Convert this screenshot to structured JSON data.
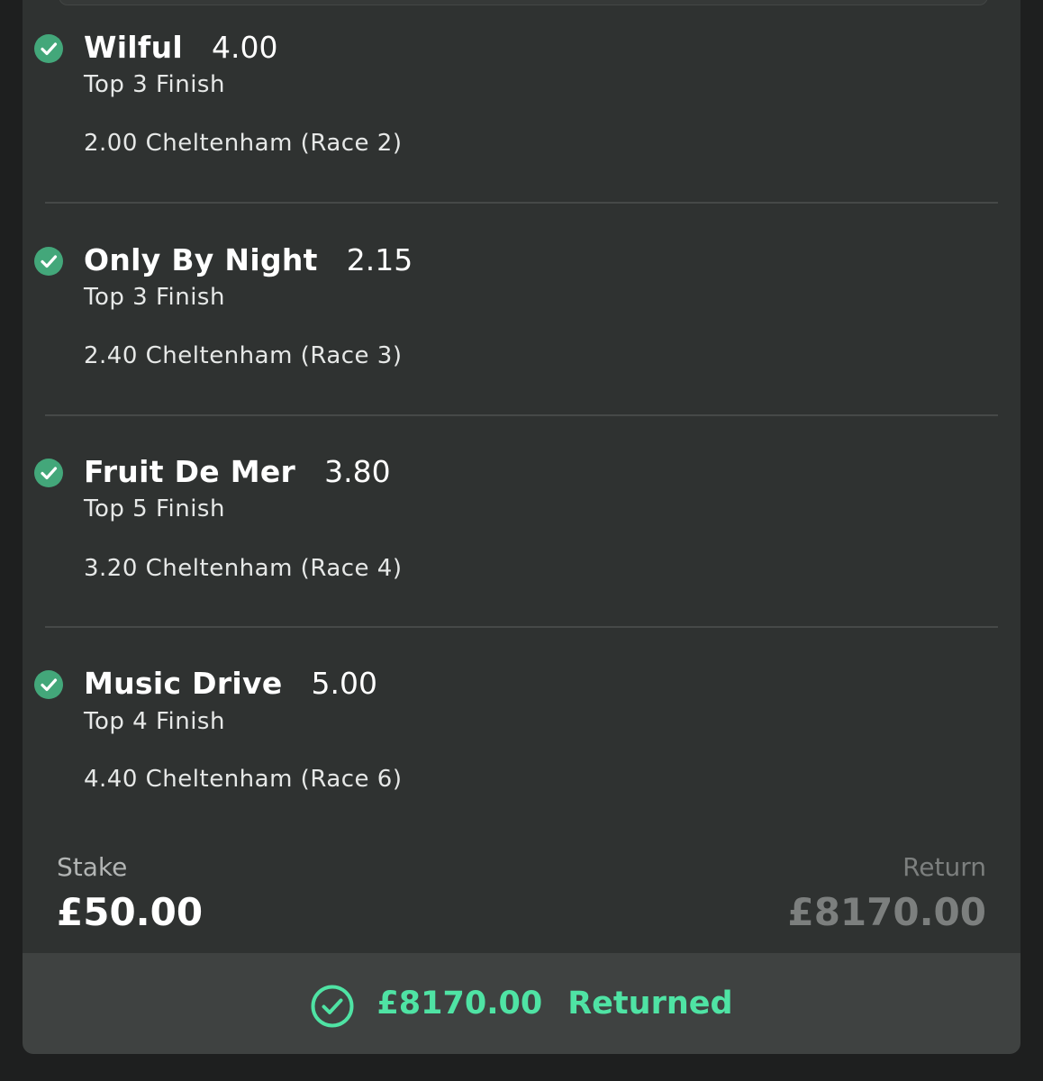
{
  "selections": [
    {
      "name": "Wilful",
      "odds": "4.00",
      "market": "Top 3 Finish",
      "event": "2.00 Cheltenham (Race 2)",
      "status_icon": "check-circle-icon"
    },
    {
      "name": "Only By Night",
      "odds": "2.15",
      "market": "Top 3 Finish",
      "event": "2.40 Cheltenham (Race 3)",
      "status_icon": "check-circle-icon"
    },
    {
      "name": "Fruit De Mer",
      "odds": "3.80",
      "market": "Top 5 Finish",
      "event": "3.20 Cheltenham (Race 4)",
      "status_icon": "check-circle-icon"
    },
    {
      "name": "Music Drive",
      "odds": "5.00",
      "market": "Top 4 Finish",
      "event": "4.40 Cheltenham (Race 6)",
      "status_icon": "check-circle-icon"
    }
  ],
  "summary": {
    "stake_label": "Stake",
    "stake_value": "£50.00",
    "return_label": "Return",
    "return_value": "£8170.00"
  },
  "returned": {
    "amount": "£8170.00",
    "label": "Returned",
    "icon": "check-circle-outline-icon"
  },
  "colors": {
    "accent_green": "#4fe3a4",
    "check_green": "#43a77a",
    "card_bg": "#2f3231"
  }
}
